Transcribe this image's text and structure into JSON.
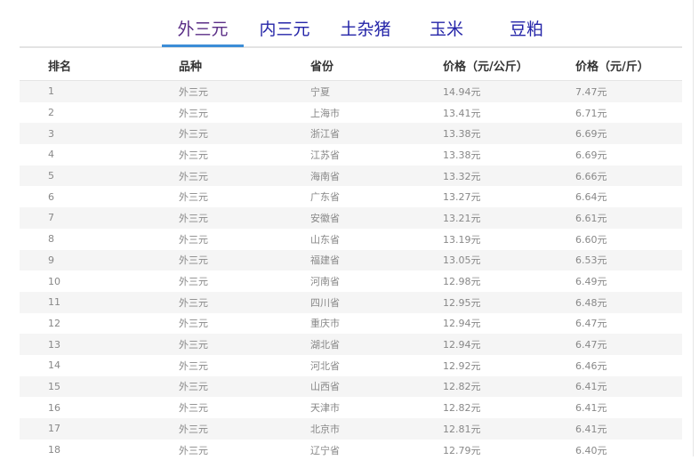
{
  "tabs": [
    {
      "label": "外三元",
      "active": true
    },
    {
      "label": "内三元",
      "active": false
    },
    {
      "label": "土杂猪",
      "active": false
    },
    {
      "label": "玉米",
      "active": false
    },
    {
      "label": "豆粕",
      "active": false
    }
  ],
  "colors": {
    "tab_text": "#2424a8",
    "tab_active_text": "#5a2d86",
    "tab_underline": "#3c8dd6",
    "stripe": "#f5f5f5"
  },
  "table": {
    "headers": [
      "排名",
      "品种",
      "省份",
      "价格（元/公斤）",
      "价格（元/斤）"
    ],
    "rows": [
      [
        "1",
        "外三元",
        "宁夏",
        "14.94元",
        "7.47元"
      ],
      [
        "2",
        "外三元",
        "上海市",
        "13.41元",
        "6.71元"
      ],
      [
        "3",
        "外三元",
        "浙江省",
        "13.38元",
        "6.69元"
      ],
      [
        "4",
        "外三元",
        "江苏省",
        "13.38元",
        "6.69元"
      ],
      [
        "5",
        "外三元",
        "海南省",
        "13.32元",
        "6.66元"
      ],
      [
        "6",
        "外三元",
        "广东省",
        "13.27元",
        "6.64元"
      ],
      [
        "7",
        "外三元",
        "安徽省",
        "13.21元",
        "6.61元"
      ],
      [
        "8",
        "外三元",
        "山东省",
        "13.19元",
        "6.60元"
      ],
      [
        "9",
        "外三元",
        "福建省",
        "13.05元",
        "6.53元"
      ],
      [
        "10",
        "外三元",
        "河南省",
        "12.98元",
        "6.49元"
      ],
      [
        "11",
        "外三元",
        "四川省",
        "12.95元",
        "6.48元"
      ],
      [
        "12",
        "外三元",
        "重庆市",
        "12.94元",
        "6.47元"
      ],
      [
        "13",
        "外三元",
        "湖北省",
        "12.94元",
        "6.47元"
      ],
      [
        "14",
        "外三元",
        "河北省",
        "12.92元",
        "6.46元"
      ],
      [
        "15",
        "外三元",
        "山西省",
        "12.82元",
        "6.41元"
      ],
      [
        "16",
        "外三元",
        "天津市",
        "12.82元",
        "6.41元"
      ],
      [
        "17",
        "外三元",
        "北京市",
        "12.81元",
        "6.41元"
      ],
      [
        "18",
        "外三元",
        "辽宁省",
        "12.79元",
        "6.40元"
      ]
    ]
  }
}
